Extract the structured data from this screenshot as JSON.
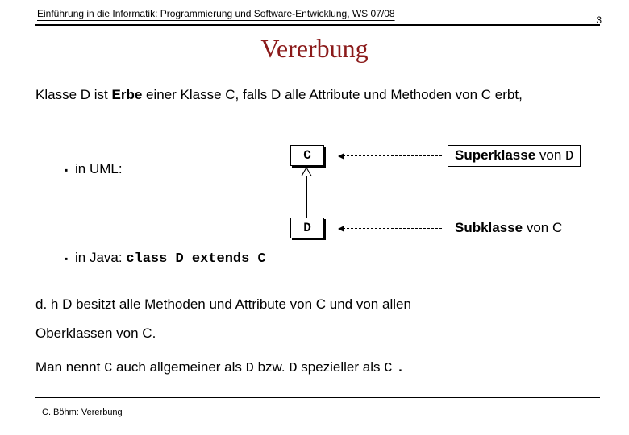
{
  "header": {
    "course": "Einführung in die Informatik: Programmierung und Software-Entwicklung, WS 07/08",
    "page": "3"
  },
  "title": "Vererbung",
  "def": {
    "pre": "Klasse D ist ",
    "erbe": "Erbe",
    "post": " einer Klasse C, falls D alle Attribute und Methoden von C erbt,"
  },
  "umlBullet": "in UML:",
  "classC": "C",
  "classD": "D",
  "superLabel": {
    "a": "Superklasse",
    "b": " von ",
    "c": "D"
  },
  "subLabel": {
    "a": "Subklasse",
    "b": " von C"
  },
  "javaBullet": {
    "a": "in Java: ",
    "code": "class D extends C"
  },
  "para1a": "d. h  D besitzt alle Methoden und Attribute von C und von allen",
  "para1b": "Oberklassen von C.",
  "para2": {
    "a": "Man nennt ",
    "c1": "C",
    "b": " auch allgemeiner als ",
    "d1": "D",
    "c": " bzw. ",
    "d2": "D",
    "d": " spezieller als ",
    "c2": "C",
    "dot": " ."
  },
  "footer": "C. Böhm: Vererbung"
}
